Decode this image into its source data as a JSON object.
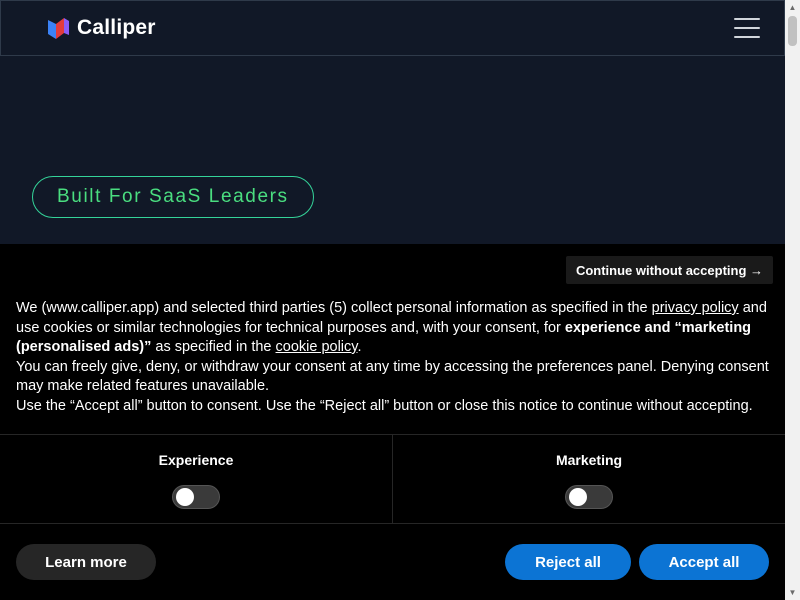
{
  "header": {
    "brand_name": "Calliper",
    "logo_icon": "calliper-logo-icon",
    "menu_icon": "hamburger-menu-icon"
  },
  "hero": {
    "tagline": "Built For SaaS Leaders"
  },
  "consent": {
    "continue_label": "Continue without accepting →",
    "notice": {
      "p1_a": "We (www.calliper.app) and selected third parties (5) collect personal information as specified in the ",
      "p1_link1": "privacy policy",
      "p1_b": " and use cookies or similar technologies for technical purposes and, with your consent, for ",
      "p1_bold": "experience and “marketing (personalised ads)”",
      "p1_c": " as specified in the ",
      "p1_link2": "cookie policy",
      "p1_d": ".",
      "p2": "You can freely give, deny, or withdraw your consent at any time by accessing the preferences panel. Denying consent may make related features unavailable.",
      "p3": "Use the “Accept all” button to consent. Use the “Reject all” button or close this notice to continue without accepting."
    },
    "preferences": [
      {
        "label": "Experience",
        "enabled": false
      },
      {
        "label": "Marketing",
        "enabled": false
      }
    ],
    "learn_more_label": "Learn more",
    "reject_label": "Reject all",
    "accept_label": "Accept all"
  },
  "colors": {
    "page_bg": "#111827",
    "accent_green": "#4ade80",
    "banner_bg": "#000000",
    "primary_button": "#0c74d4"
  }
}
